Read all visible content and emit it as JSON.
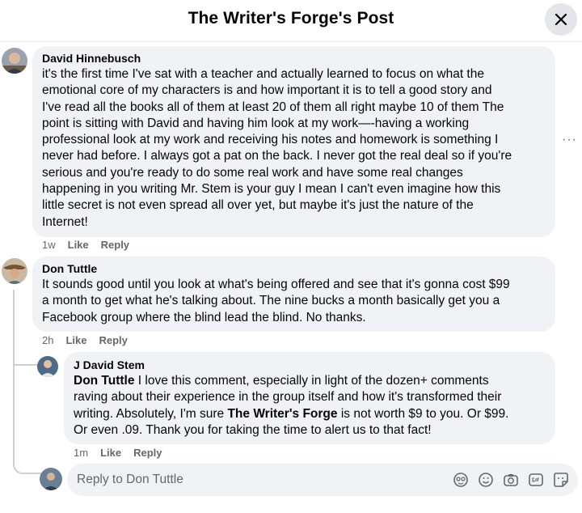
{
  "header": {
    "title": "The Writer's Forge's Post"
  },
  "comments": [
    {
      "author": "David Hinnebusch",
      "text": "it's the first time I've sat with a teacher and actually learned to focus on what the\nemotional core of my characters is and how important it is to tell a good story and\nI've read all the books all of them at least 20 of them all right maybe 10 of them The\npoint is sitting with David and having him look at my work—-having a working\nprofessional look at my work and receiving his notes and homework is something I\nnever had before. I always got a pat on the back. I never got the real deal so if you're\nserious and you're ready to do some real work and have some real changes\nhappening in you writing Mr. Stem is your guy I mean I can't even imagine how this\nlittle secret is not even spread all over yet, but maybe it's just the nature of the\nInternet!",
      "time": "1w",
      "like": "Like",
      "reply": "Reply"
    },
    {
      "author": "Don Tuttle",
      "text": "It sounds good until you look at what's being offered and see that it's gonna cost $99\na month to get what he's talking about. The nine bucks a month basically get you a\nFacebook group where the blind lead the blind. No thanks.",
      "time": "2h",
      "like": "Like",
      "reply": "Reply"
    }
  ],
  "reply": {
    "author": "J David Stem",
    "mention": "Don Tuttle",
    "text_1": " I love this comment, especially in light of the dozen+ comments\nraving about their experience in the group itself and how it's transformed their\nwriting. Absolutely, I'm sure ",
    "bold_2": "The Writer's Forge",
    "text_2": " is not worth $9 to you. Or $99.\nOr even .09. Thank you for taking the time to alert us to that fact!",
    "time": "1m",
    "like": "Like",
    "reply": "Reply"
  },
  "more_options": "···",
  "reply_box": {
    "placeholder": "Reply to Don Tuttle"
  },
  "icons": [
    "close-icon",
    "more-options-icon",
    "avatar-icon",
    "sticker-icon",
    "emoji-icon",
    "camera-icon",
    "gif-icon",
    "emoji-sticker-icon"
  ],
  "colors": {
    "bubble": "#f0f2f5",
    "secondary_text": "#65676b",
    "close_bg": "#e4e6eb",
    "thread_line": "#ccd0d5"
  }
}
